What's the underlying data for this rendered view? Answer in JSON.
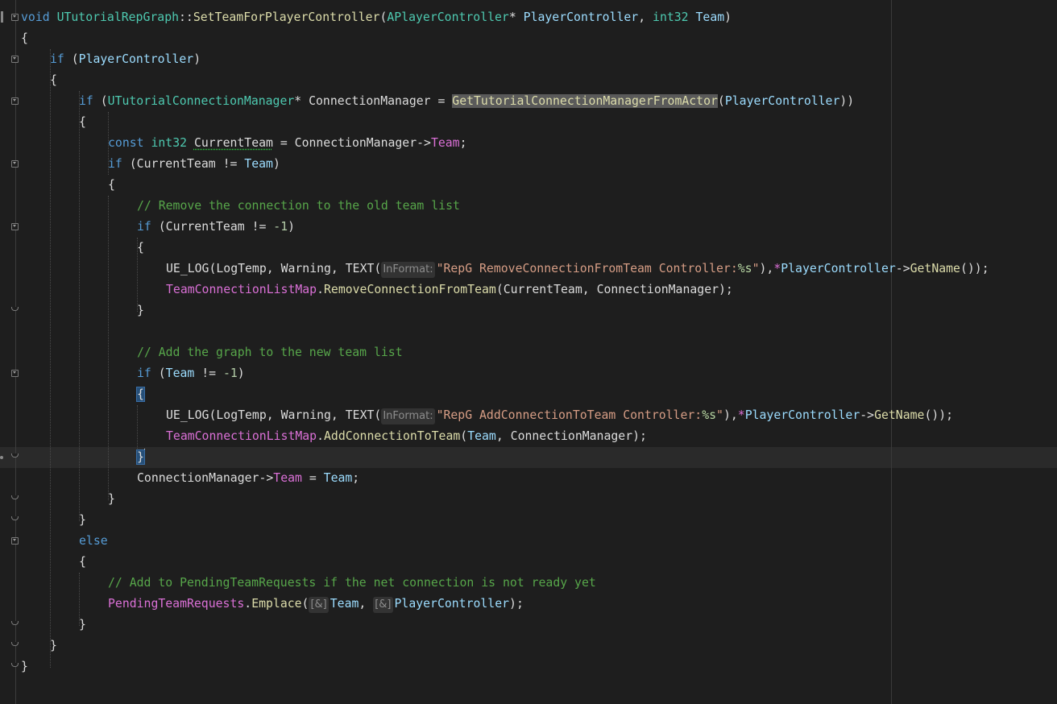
{
  "editor": {
    "language": "C++",
    "theme_colors": {
      "background": "#1e1e1e",
      "keyword": "#569cd6",
      "type": "#4ec9b0",
      "function": "#dcdcaa",
      "member": "#da70d6",
      "string": "#d69d85",
      "comment": "#57a64a"
    },
    "current_line": 22
  },
  "code": {
    "l1": {
      "kw_void": "void",
      "class": "UTutorialRepGraph",
      "scope": "::",
      "func": "SetTeamForPlayerController",
      "open": "(",
      "param_type": "APlayerController",
      "ptr": "* ",
      "param_name": "PlayerController",
      "comma": ", ",
      "int_type": "int32",
      "sp": " ",
      "team_param": "Team",
      "close": ")"
    },
    "l2": "{",
    "l3": {
      "kw_if": "if",
      "rest_open": " (",
      "pc": "PlayerController",
      "rest_close": ")"
    },
    "l4": "{",
    "l5": {
      "kw_if": "if",
      "open": " (",
      "type": "UTutorialConnectionManager",
      "ptr": "* ",
      "var": "ConnectionManager",
      "eq": " = ",
      "func": "GetTutorialConnectionManagerFromActor",
      "arg_open": "(",
      "arg": "PlayerController",
      "close": "))"
    },
    "l6": "{",
    "l7": {
      "kw_const": "const",
      "type": "int32",
      "var": "CurrentTeam",
      "eq": " = ",
      "obj": "ConnectionManager",
      "arrow": "->",
      "mem": "Team",
      "semi": ";"
    },
    "l8": {
      "kw_if": "if",
      "open": " (",
      "a": "CurrentTeam",
      "op": " != ",
      "b": "Team",
      "close": ")"
    },
    "l9": "{",
    "l10": "// Remove the connection to the old team list",
    "l11": {
      "kw_if": "if",
      "open": " (",
      "a": "CurrentTeam",
      "op": " != ",
      "num": "-1",
      "close": ")"
    },
    "l12": "{",
    "l13": {
      "macro": "UE_LOG",
      "open": "(",
      "cat": "LogTemp",
      "comma1": ", ",
      "verb": "Warning",
      "comma2": ", ",
      "text": "TEXT",
      "paren": "(",
      "hint": "InFormat:",
      "str_a": "\"RepG RemoveConnectionFromTeam Controller:",
      "fmt": "%s",
      "str_b": "\"",
      "close1": "),",
      "deref": "*",
      "obj": "PlayerController",
      "arrow": "->",
      "call": "GetName",
      "close2": "());"
    },
    "l14": {
      "obj": "TeamConnectionListMap",
      "dot": ".",
      "call": "RemoveConnectionFromTeam",
      "open": "(",
      "a": "CurrentTeam",
      "comma": ", ",
      "b": "ConnectionManager",
      "close": ");"
    },
    "l15": "}",
    "l17": "// Add the graph to the new team list",
    "l18": {
      "kw_if": "if",
      "open": " (",
      "a": "Team",
      "op": " != ",
      "num": "-1",
      "close": ")"
    },
    "l19": "{",
    "l20": {
      "macro": "UE_LOG",
      "open": "(",
      "cat": "LogTemp",
      "comma1": ", ",
      "verb": "Warning",
      "comma2": ", ",
      "text": "TEXT",
      "paren": "(",
      "hint": "InFormat:",
      "str_a": "\"RepG AddConnectionToTeam Controller:",
      "fmt": "%s",
      "str_b": "\"",
      "close1": "),",
      "deref": "*",
      "obj": "PlayerController",
      "arrow": "->",
      "call": "GetName",
      "close2": "());"
    },
    "l21": {
      "obj": "TeamConnectionListMap",
      "dot": ".",
      "call": "AddConnectionToTeam",
      "open": "(",
      "a": "Team",
      "comma": ", ",
      "b": "ConnectionManager",
      "close": ");"
    },
    "l22": "}",
    "l23": {
      "obj": "ConnectionManager",
      "arrow": "->",
      "mem": "Team",
      "eq": " = ",
      "val": "Team",
      "semi": ";"
    },
    "l24": "}",
    "l25": "}",
    "l26": "else",
    "l27": "{",
    "l28": "// Add to PendingTeamRequests if the net connection is not ready yet",
    "l29": {
      "obj": "PendingTeamRequests",
      "dot": ".",
      "call": "Emplace",
      "open": "(",
      "hint1": "[&]",
      "a": "Team",
      "comma": ", ",
      "hint2": "[&]",
      "b": "PlayerController",
      "close": ");"
    },
    "l30": "}",
    "l31": "}",
    "l32": "}"
  }
}
